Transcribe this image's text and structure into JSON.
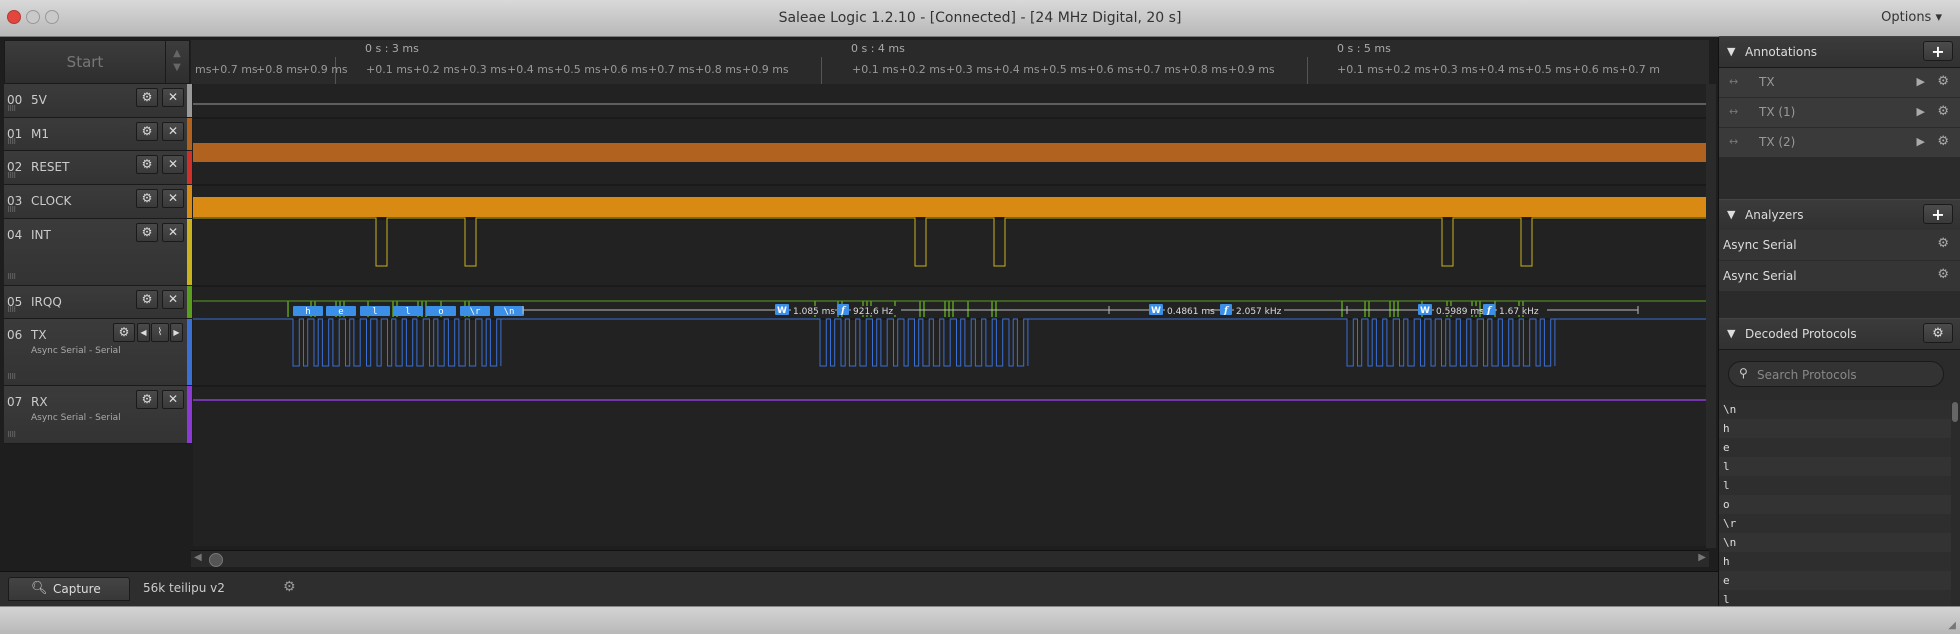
{
  "window": {
    "title": "Saleae Logic 1.2.10 - [Connected] - [24 MHz Digital, 20 s]",
    "options_label": "Options ▾"
  },
  "toolbar": {
    "start_label": "Start"
  },
  "ruler": {
    "major": [
      "0 s : 3 ms",
      "0 s : 4 ms",
      "0 s : 5 ms"
    ],
    "minor": [
      "ms",
      "+0.7 ms",
      "+0.8 ms",
      "+0.9 ms",
      "+0.1 ms",
      "+0.2 ms",
      "+0.3 ms",
      "+0.4 ms",
      "+0.5 ms",
      "+0.6 ms",
      "+0.7 ms",
      "+0.8 ms",
      "+0.9 ms",
      "+0.1 ms",
      "+0.2 ms",
      "+0.3 ms",
      "+0.4 ms",
      "+0.5 ms",
      "+0.6 ms",
      "+0.7 ms",
      "+0.8 ms",
      "+0.9 ms",
      "+0.1 ms",
      "+0.2 ms",
      "+0.3 ms",
      "+0.4 ms",
      "+0.5 ms",
      "+0.6 ms",
      "+0.7 m"
    ]
  },
  "channels": [
    {
      "num": "00",
      "name": "5V",
      "sub": "",
      "color": "#9a9a9a"
    },
    {
      "num": "01",
      "name": "M1",
      "sub": "",
      "color": "#b2621f"
    },
    {
      "num": "02",
      "name": "RESET",
      "sub": "",
      "color": "#d0302a"
    },
    {
      "num": "03",
      "name": "CLOCK",
      "sub": "",
      "color": "#d98a12"
    },
    {
      "num": "04",
      "name": "INT",
      "sub": "",
      "color": "#c8b21d"
    },
    {
      "num": "05",
      "name": "IRQQ",
      "sub": "",
      "color": "#5a9e1d"
    },
    {
      "num": "06",
      "name": "TX",
      "sub": "Async Serial - Serial",
      "color": "#3a6fd6"
    },
    {
      "num": "07",
      "name": "RX",
      "sub": "Async Serial - Serial",
      "color": "#8b3ad6"
    }
  ],
  "decode_bubbles": [
    "h",
    "e",
    "l",
    "l",
    "o",
    "\\r",
    "\\n"
  ],
  "measurements": [
    {
      "w": "1.085 ms",
      "f": "921.6 Hz"
    },
    {
      "w": "0.4861 ms",
      "f": "2.057 kHz"
    },
    {
      "w": "0.5989 ms",
      "f": "1.67 kHz"
    }
  ],
  "measure_labels": {
    "width": "W",
    "freq": "f"
  },
  "tabs": {
    "capture": "Capture",
    "session": "56k teilipu v2"
  },
  "annotations": {
    "title": "Annotations",
    "items": [
      "TX",
      "TX (1)",
      "TX (2)"
    ]
  },
  "analyzers": {
    "title": "Analyzers",
    "items": [
      "Async Serial",
      "Async Serial"
    ]
  },
  "decoded": {
    "title": "Decoded Protocols",
    "search_placeholder": "Search Protocols",
    "items": [
      "\\n",
      "h",
      "e",
      "l",
      "l",
      "o",
      "\\r",
      "\\n",
      "h",
      "e",
      "l"
    ]
  },
  "icons": {
    "gear": "gear-icon",
    "close": "close-icon",
    "add": "plus-icon",
    "search": "search-icon"
  }
}
